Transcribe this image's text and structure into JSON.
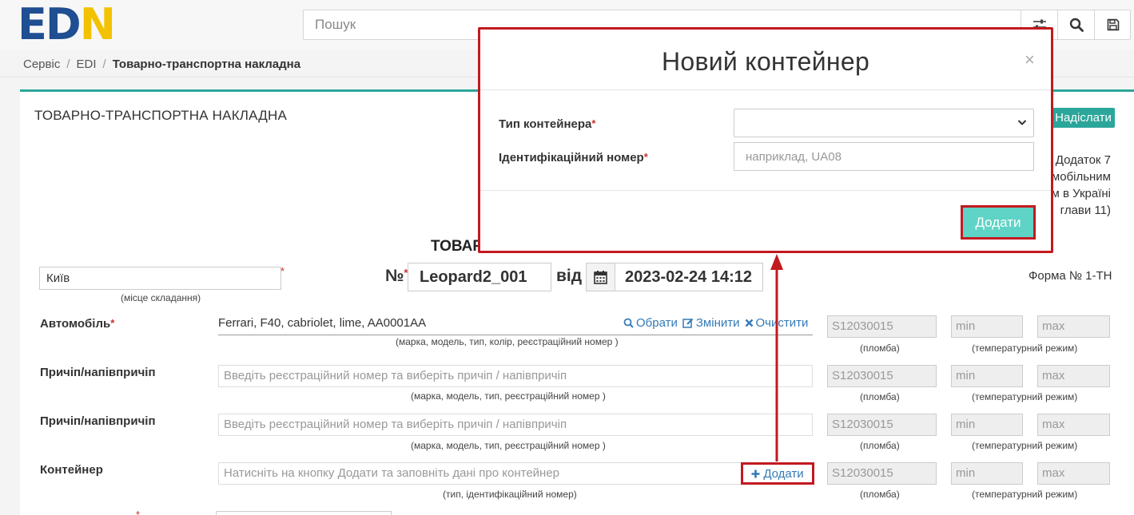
{
  "header": {
    "logo_left": "ED",
    "logo_right": "N",
    "search_placeholder": "Пошук",
    "icons": [
      "filter-sliders-icon",
      "search-icon",
      "save-icon"
    ]
  },
  "breadcrumb": {
    "items": [
      "Сервіс",
      "EDI"
    ],
    "separator": "/",
    "current": "Товарно-транспортна накладна"
  },
  "panel": {
    "title": "ТОВАРНО-ТРАНСПОРТНА НАКЛАДНА",
    "send_label": "Надіслати",
    "note_lines": [
      "Додаток 7",
      "мобільним",
      "м в Україні",
      "глави 11)"
    ],
    "heading_fragment": "ТОВАР",
    "city_value": "Київ",
    "city_caption": "(місце складання)",
    "number_label": "№",
    "number_value": "Leopard2_001",
    "from_label": "від",
    "date_value": "2023-02-24 14:12",
    "form_number": "Форма № 1-ТН",
    "required_mark": "*"
  },
  "rows": [
    {
      "label": "Автомобіль",
      "value": "Ferrari, F40, cabriolet, lime, AA0001AA",
      "caption": "(марка, модель, тип, колір, реєстраційний номер )",
      "seal_placeholder": "S12030015",
      "min_placeholder": "min",
      "max_placeholder": "max"
    },
    {
      "label": "Причіп/напівпричіп",
      "placeholder": "Введіть реєстраційний номер та виберіть причіп / напівпричіп",
      "caption": "(марка, модель, тип, реєстраційний номер )",
      "seal_placeholder": "S12030015",
      "min_placeholder": "min",
      "max_placeholder": "max"
    },
    {
      "label": "Причіп/напівпричіп",
      "placeholder": "Введіть реєстраційний номер та виберіть причіп / напівпричіп",
      "caption": "(марка, модель, тип, реєстраційний номер )",
      "seal_placeholder": "S12030015",
      "min_placeholder": "min",
      "max_placeholder": "max"
    },
    {
      "label": "Контейнер",
      "placeholder": "Натисніть на кнопку Додати та заповніть дані про контейнер",
      "caption": "(тип, ідентифікаційний номер)",
      "seal_placeholder": "S12030015",
      "min_placeholder": "min",
      "max_placeholder": "max"
    }
  ],
  "captions": {
    "seal": "(пломба)",
    "temperature": "(температурний режим)"
  },
  "vehicle_actions": {
    "choose": "Обрати",
    "change": "Змінити",
    "clear": "Очистити"
  },
  "container_add_label": "Додати",
  "modal": {
    "title": "Новий контейнер",
    "close_symbol": "×",
    "type_label": "Тип контейнера",
    "id_label": "Ідентифікаційний номер",
    "id_placeholder": "наприклад, UA08",
    "add_button": "Додати"
  },
  "colors": {
    "accent": "#2ba69a",
    "highlight": "#c2191f",
    "modal_button": "#5fd3c6",
    "link": "#337ab7",
    "logo_blue": "#1f4e92",
    "logo_yellow": "#f2c200"
  }
}
